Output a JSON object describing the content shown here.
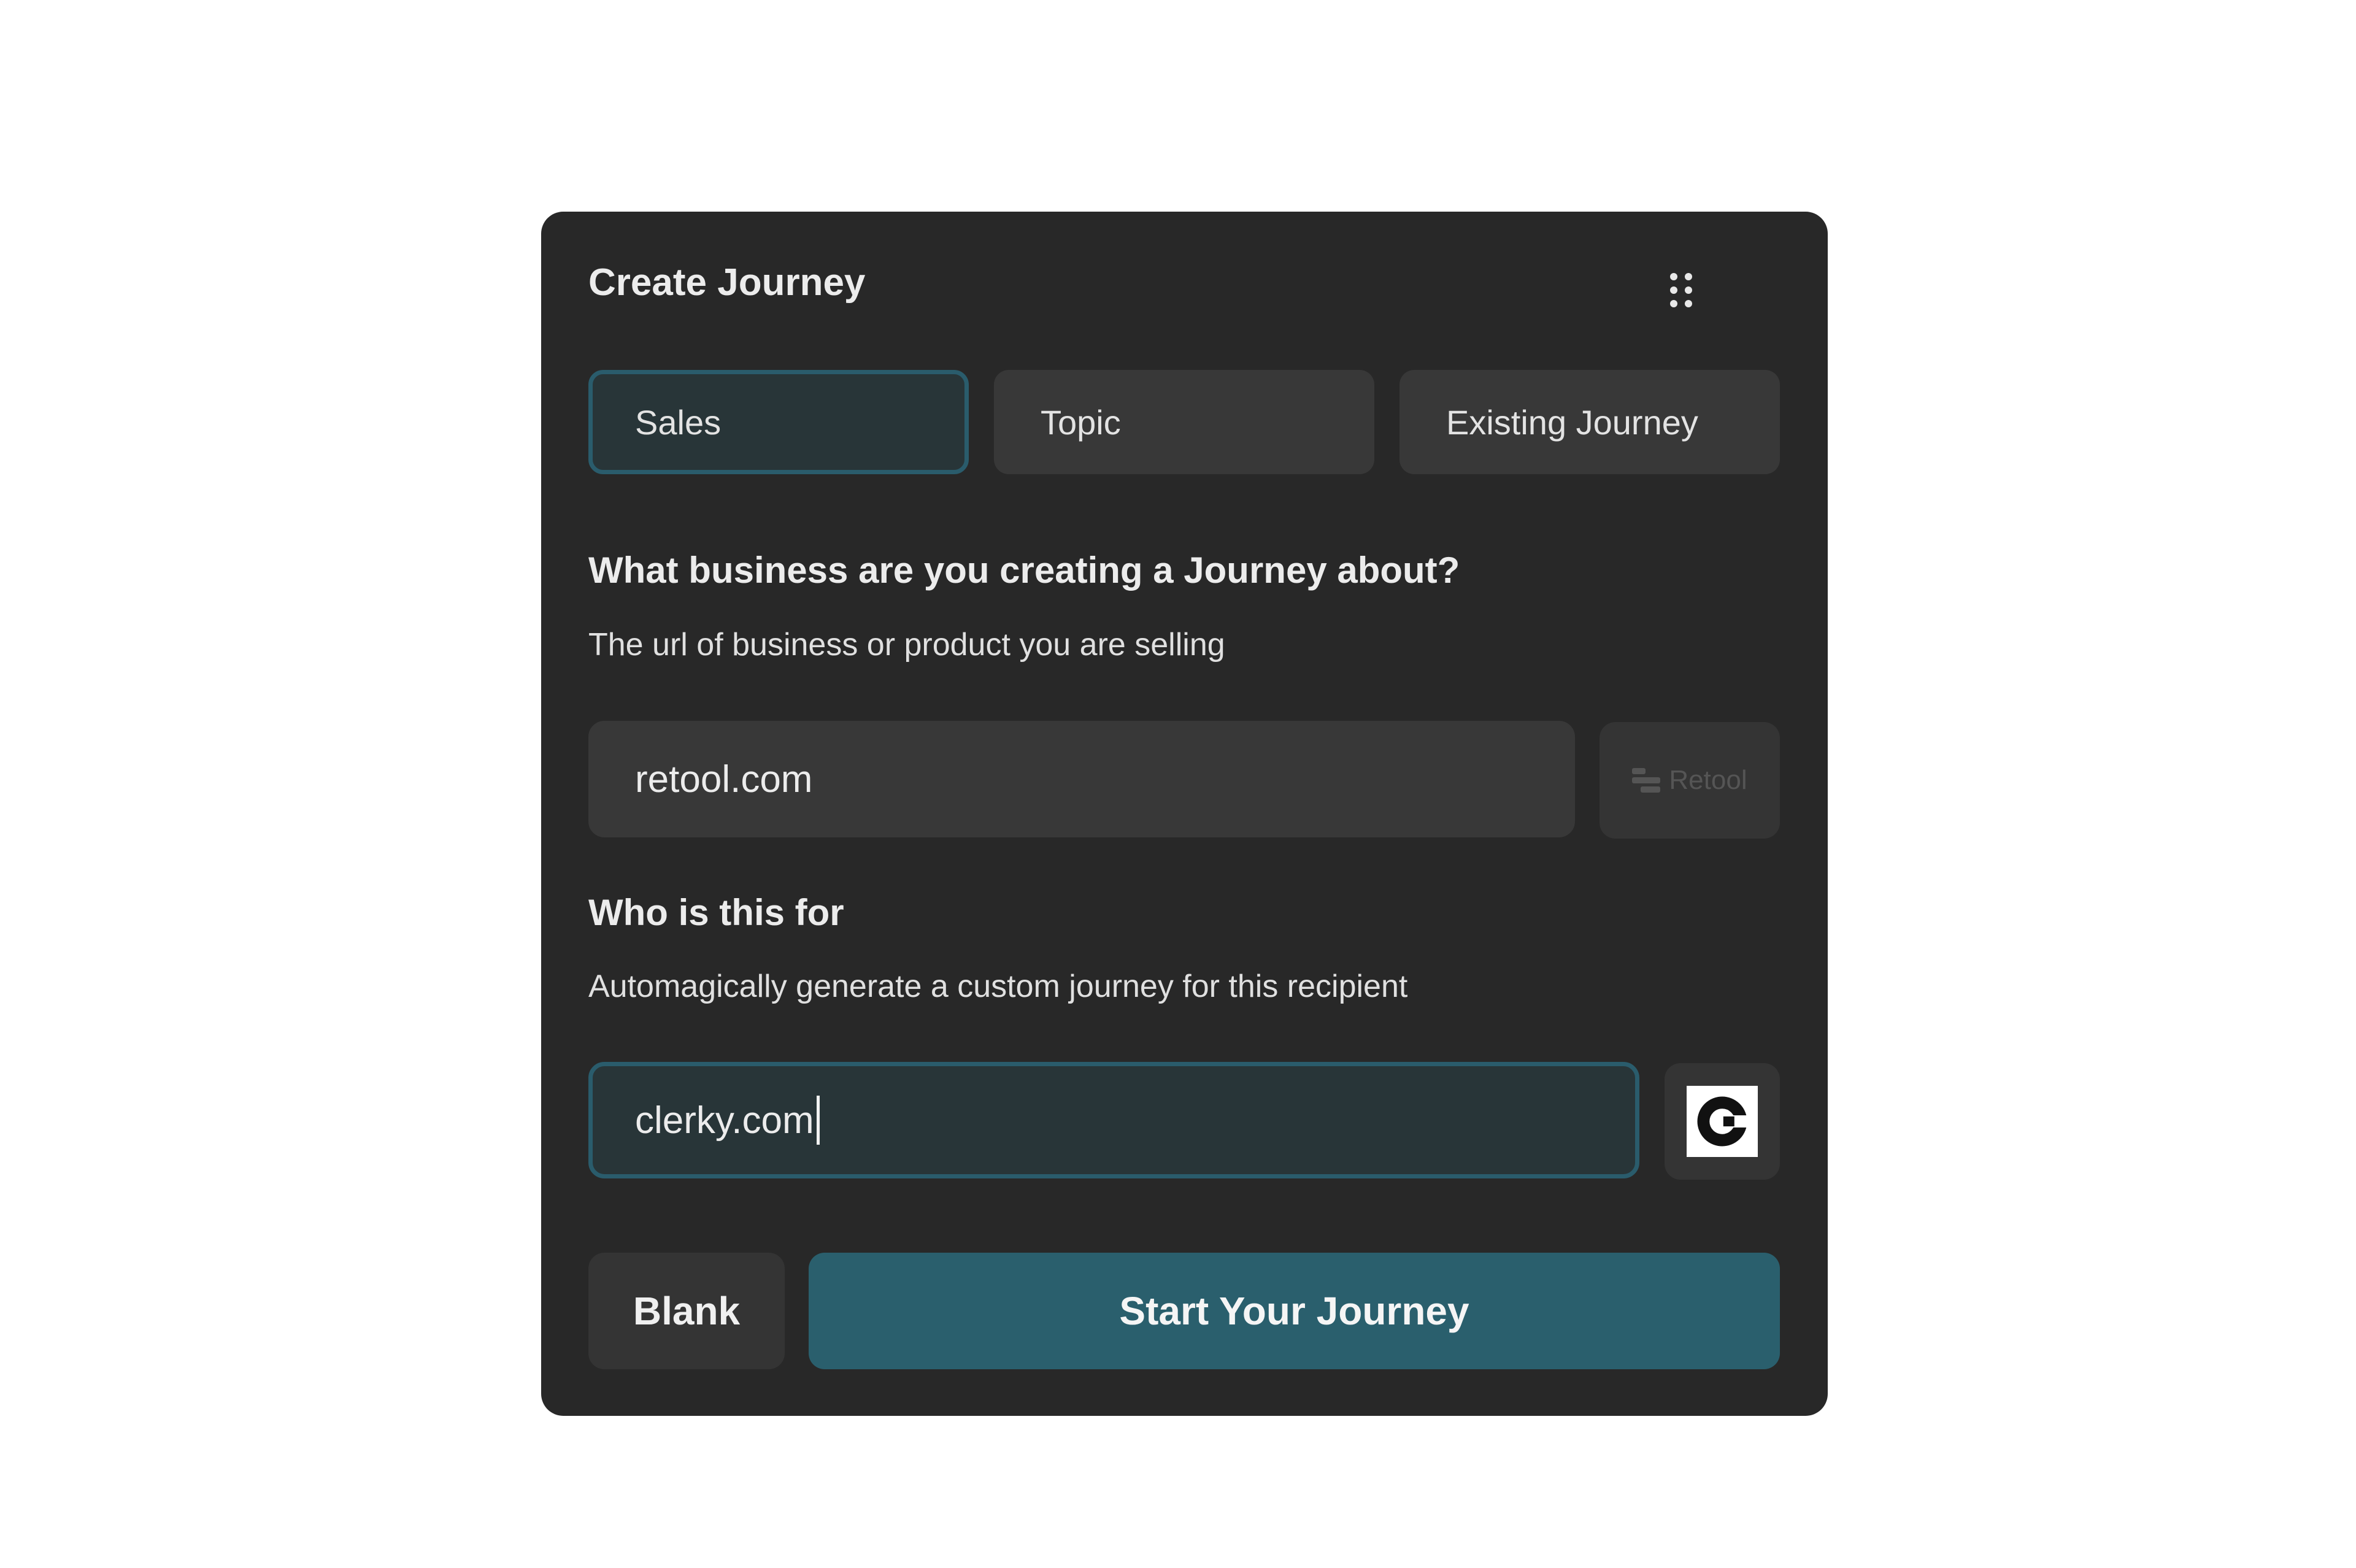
{
  "dialog": {
    "title": "Create Journey",
    "menu_icon": "drag-handle-icon"
  },
  "tabs": [
    {
      "label": "Sales",
      "active": true
    },
    {
      "label": "Topic",
      "active": false
    },
    {
      "label": "Existing Journey",
      "active": false
    }
  ],
  "business": {
    "heading": "What business are you creating a Journey about?",
    "description": "The url of business or product you are selling",
    "value": "retool.com",
    "logo_label": "Retool",
    "logo_icon": "retool-logo-icon"
  },
  "recipient": {
    "heading": "Who is this for",
    "description": "Automagically generate a custom journey for this recipient",
    "value": "clerky.com",
    "logo_icon": "clerky-logo-icon"
  },
  "actions": {
    "blank_label": "Blank",
    "start_label": "Start Your Journey"
  },
  "colors": {
    "panel_bg": "#282828",
    "accent": "#2a5f6d",
    "accent_border": "#2a5c6c",
    "field_bg": "#383838"
  }
}
